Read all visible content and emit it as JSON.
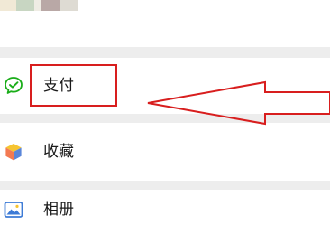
{
  "colors": {
    "annotation": "#d81e1e",
    "pay_icon": "#1aad19",
    "background": "#ededed"
  },
  "menu": {
    "items": [
      {
        "label": "支付",
        "icon": "wechat-pay-icon"
      },
      {
        "label": "收藏",
        "icon": "favorites-cube-icon"
      },
      {
        "label": "相册",
        "icon": "album-picture-icon"
      }
    ]
  },
  "annotation": {
    "highlighted_item": "支付",
    "pointer": "arrow-pointing-left"
  }
}
